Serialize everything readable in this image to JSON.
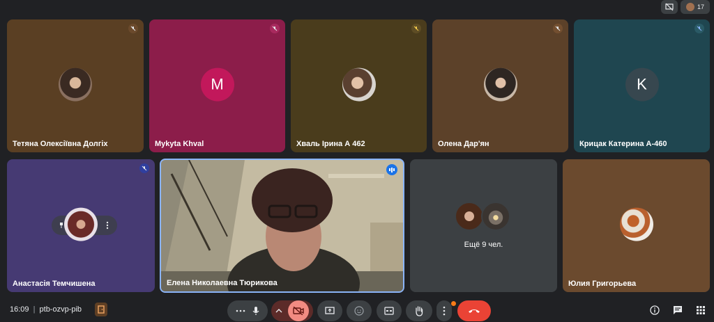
{
  "top": {
    "participant_count": "17"
  },
  "tiles": [
    {
      "name": "Тетяна Олексіївна Долгіх"
    },
    {
      "name": "Mykyta Khval",
      "avatar_letter": "M"
    },
    {
      "name": "Хваль Ірина А 462"
    },
    {
      "name": "Олена Дар'ян"
    },
    {
      "name": "Крицак Катерина А-460",
      "avatar_letter": "K"
    },
    {
      "name": "Анастасія Темчишена"
    },
    {
      "name": "Елена Николаевна Тюрикова"
    },
    {
      "name": "Ещё 9 чел."
    },
    {
      "name": "Юлия Григорьева"
    }
  ],
  "meeting": {
    "time": "16:09",
    "separator": "|",
    "code": "ptb-ozvp-pib"
  },
  "colors": {
    "background": "#202124",
    "end_call": "#ea4335",
    "camera_off": "#f28b82",
    "notification_dot": "#fa7b17"
  },
  "icons": [
    "mic-off-icon",
    "more-icon",
    "mic-icon",
    "chevron-up-icon",
    "camera-off-icon",
    "present-icon",
    "emoji-icon",
    "captions-icon",
    "raise-hand-icon",
    "end-call-icon",
    "info-icon",
    "chat-icon",
    "activities-icon"
  ]
}
